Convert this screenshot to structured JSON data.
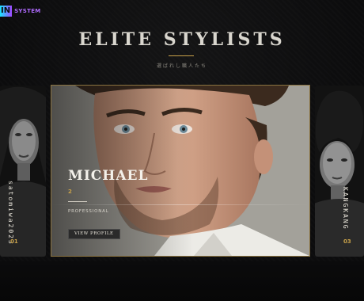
{
  "brand": {
    "mark": "IN",
    "text": "SYSTEM",
    "accent_from": "#19e3ff",
    "accent_to": "#a048ff"
  },
  "header": {
    "title": "ELITE STYLISTS",
    "subtitle": "選ばれし職人たち",
    "rule_color": "#c9a24a"
  },
  "featured": {
    "name": "MICHAEL",
    "number": "2",
    "role": "PROFESSIONAL",
    "button_label": "VIEW PROFILE",
    "border_color": "#8a7340"
  },
  "previous": {
    "name": "satomiwa2023",
    "number": "01"
  },
  "next": {
    "name": "KANGKANG",
    "number": "03"
  },
  "colors": {
    "gold": "#c9a24a",
    "background": "#0c0c0d"
  }
}
